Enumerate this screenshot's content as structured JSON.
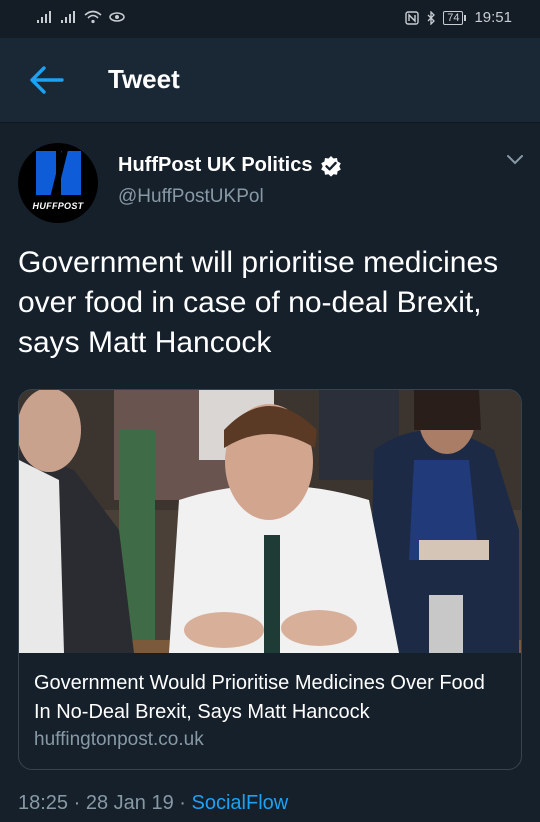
{
  "status_bar": {
    "battery": "74",
    "time": "19:51"
  },
  "header": {
    "title": "Tweet",
    "back_icon": "arrow-left-icon"
  },
  "tweet": {
    "author_name": "HuffPost UK Politics",
    "handle": "@HuffPostUKPol",
    "avatar_text": "HUFFPOST",
    "text": "Government will prioritise medicines over food in case of no-deal Brexit, says Matt Hancock",
    "card": {
      "title": "Government Would Prioritise Medicines Over Food In No-Deal Brexit, Says Matt Hancock",
      "domain": "huffingtonpost.co.uk"
    },
    "time": "18:25",
    "separator1": "·",
    "date": "28 Jan 19",
    "separator2": "·",
    "source": "SocialFlow"
  },
  "colors": {
    "background": "#15202b",
    "accent": "#1da1f2",
    "muted": "#8899a6"
  }
}
